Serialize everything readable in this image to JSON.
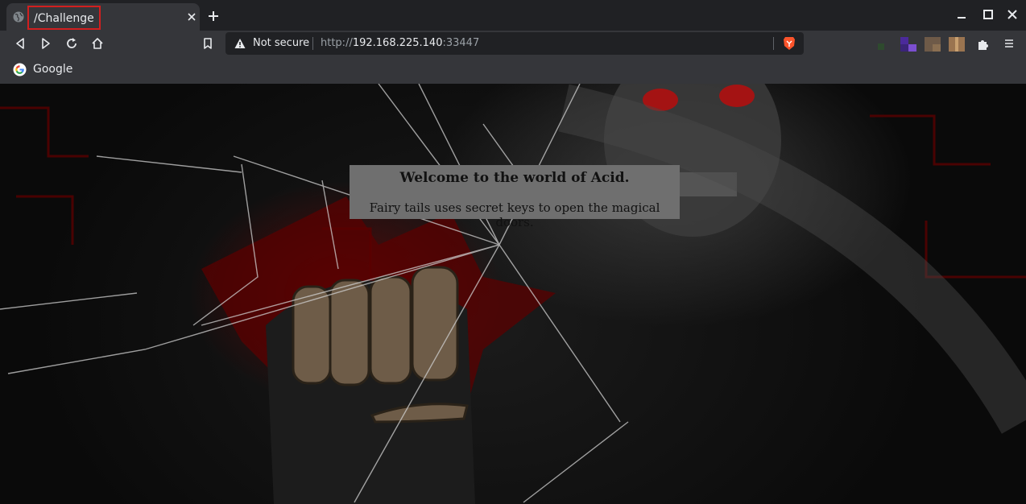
{
  "tab": {
    "title": "/Challenge",
    "favicon": "globe-icon"
  },
  "address_bar": {
    "security_label": "Not secure",
    "url_scheme": "http://",
    "url_host": "192.168.225.140",
    "url_port": ":33447"
  },
  "bookmarks": [
    {
      "label": "Google",
      "icon": "google-icon"
    }
  ],
  "page": {
    "heading": "Welcome to the world of Acid.",
    "message": "Fairy tails uses secret keys to open the magical doors."
  },
  "colors": {
    "highlight_box": "#d21f1f",
    "brave_accent": "#fb542b",
    "content_box": "#6f6f6f"
  }
}
